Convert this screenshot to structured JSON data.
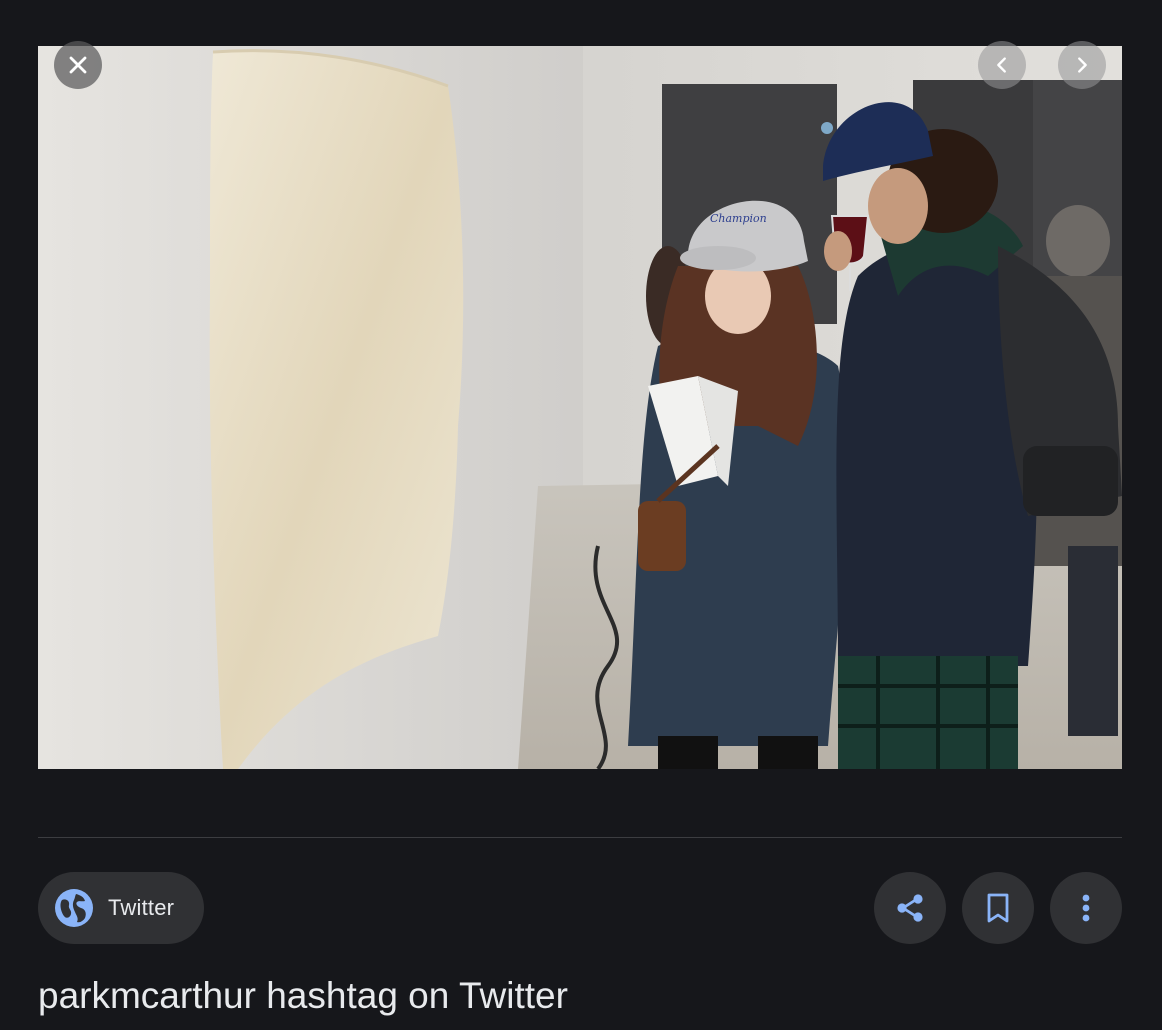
{
  "source": {
    "label": "Twitter",
    "icon": "globe-icon"
  },
  "title": "parkmcarthur hashtag on Twitter",
  "controls": {
    "close_icon": "close-icon",
    "prev_icon": "chevron-left-icon",
    "next_icon": "chevron-right-icon",
    "share_icon": "share-icon",
    "save_icon": "bookmark-icon",
    "more_icon": "more-vert-icon"
  },
  "image": {
    "cap_text": "Champion"
  },
  "colors": {
    "background": "#16171b",
    "chip": "#303134",
    "accent": "#8ab4f8",
    "text": "#e8eaed"
  }
}
